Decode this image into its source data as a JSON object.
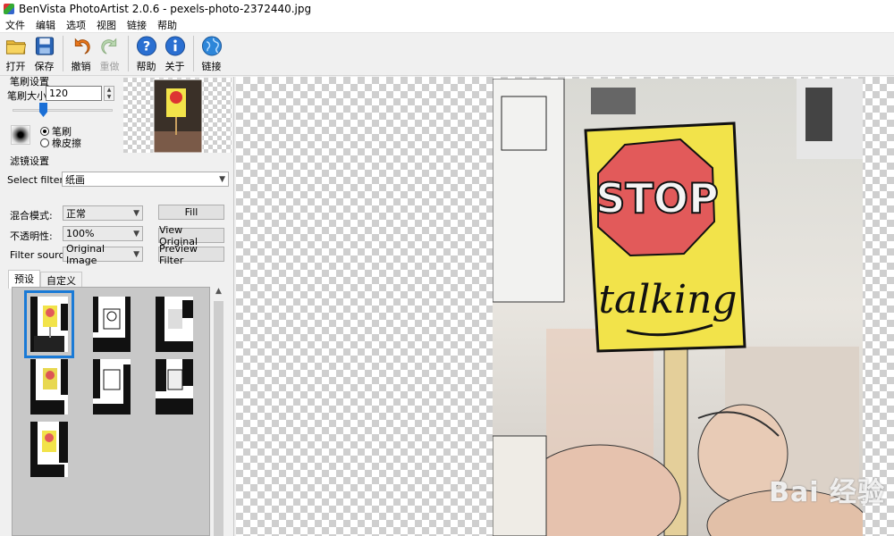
{
  "window": {
    "title": "BenVista PhotoArtist 2.0.6 - pexels-photo-2372440.jpg"
  },
  "menu": [
    "文件",
    "编辑",
    "选项",
    "视图",
    "链接",
    "帮助"
  ],
  "toolbar": {
    "open": "打开",
    "save": "保存",
    "undo": "撤销",
    "redo": "重做",
    "help": "帮助",
    "about": "关于",
    "link": "链接"
  },
  "brush": {
    "group_title": "笔刷设置",
    "size_label": "笔刷大小:",
    "size_value": "120",
    "mode_brush": "笔刷",
    "mode_eraser": "橡皮擦",
    "selected_mode": "brush"
  },
  "filter": {
    "group_title": "滤镜设置",
    "select_label": "Select filter:",
    "selected_filter": "纸画",
    "blend_label": "混合模式:",
    "blend_value": "正常",
    "opacity_label": "不透明性:",
    "opacity_value": "100%",
    "source_label": "Filter source:",
    "source_value": "Original Image",
    "fill_button": "Fill",
    "view_original_button": "View Original",
    "preview_filter_button": "Preview Filter"
  },
  "tabs": [
    "预设",
    "自定义"
  ],
  "presets": {
    "count": 7,
    "selected_index": 0
  },
  "image": {
    "sign_text_1": "STOP",
    "sign_text_2": "talking"
  },
  "watermark": "Bai 经验",
  "colors": {
    "accent": "#1a7ad6",
    "sign_yellow": "#f2e34a",
    "sign_red": "#e25a5a"
  }
}
